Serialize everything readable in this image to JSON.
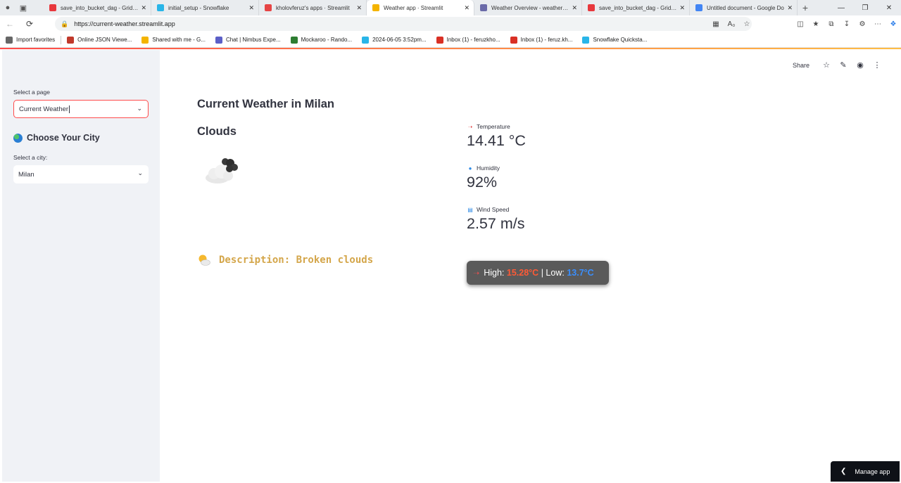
{
  "browser": {
    "tabs": [
      {
        "title": "save_into_bucket_dag - Grid - A",
        "favicon": "airflow-icon",
        "color": "#e8383d",
        "active": false
      },
      {
        "title": "initial_setup - Snowflake",
        "favicon": "snowflake-icon",
        "color": "#29b5e8",
        "active": false
      },
      {
        "title": "kholovferuz's apps · Streamlit",
        "favicon": "streamlit-icon",
        "color": "#e64545",
        "active": false
      },
      {
        "title": "Weather app · Streamlit",
        "favicon": "sun-icon",
        "color": "#f4b400",
        "active": true
      },
      {
        "title": "Weather Overview - weather_sc",
        "favicon": "globe-icon",
        "color": "#6a6aa8",
        "active": false
      },
      {
        "title": "save_into_bucket_dag - Grid - V",
        "favicon": "airflow-icon",
        "color": "#e8383d",
        "active": false
      },
      {
        "title": "Untitled document - Google Do",
        "favicon": "docs-icon",
        "color": "#4285f4",
        "active": false
      }
    ],
    "url": "https://current-weather.streamlit.app",
    "bookmarks": [
      {
        "label": "Import favorites",
        "icon": "import-icon",
        "color": "#666666"
      },
      {
        "label": "Online JSON Viewe...",
        "icon": "json-icon",
        "color": "#c0392b"
      },
      {
        "label": "Shared with me - G...",
        "icon": "drive-icon",
        "color": "#f4b400"
      },
      {
        "label": "Chat | Nimbus Expe...",
        "icon": "teams-icon",
        "color": "#5b5fc7"
      },
      {
        "label": "Mockaroo - Rando...",
        "icon": "mockaroo-icon",
        "color": "#2e7d32"
      },
      {
        "label": "2024-06-05 3:52pm...",
        "icon": "snowflake-icon",
        "color": "#29b5e8"
      },
      {
        "label": "Inbox (1) - feruzkho...",
        "icon": "gmail-icon",
        "color": "#d93025"
      },
      {
        "label": "Inbox (1) - feruz.kh...",
        "icon": "gmail-icon",
        "color": "#d93025"
      },
      {
        "label": "Snowflake Quicksta...",
        "icon": "snowflake-icon",
        "color": "#29b5e8"
      }
    ]
  },
  "sidebar": {
    "page_label": "Select a page",
    "page_value": "Current Weather",
    "heading": "Choose Your City",
    "city_label": "Select a city:",
    "city_value": "Milan"
  },
  "toolbar": {
    "share_label": "Share"
  },
  "weather": {
    "title": "Current Weather in Milan",
    "condition": "Clouds",
    "temperature_label": "Temperature",
    "temperature_value": "14.41 °C",
    "humidity_label": "Humidity",
    "humidity_value": "92%",
    "wind_label": "Wind Speed",
    "wind_value": "2.57 m/s",
    "description": "Description: Broken clouds",
    "high_label": "High:",
    "high_value": "15.28°C",
    "separator": "|",
    "low_label": "Low:",
    "low_value": "13.7°C"
  },
  "manage_app": {
    "label": "Manage app"
  },
  "colors": {
    "accent": "#ff4b4b",
    "sidebar_bg": "#f0f2f6",
    "description": "#d4a64a",
    "high": "#ff5a36",
    "low": "#3a8fff"
  }
}
